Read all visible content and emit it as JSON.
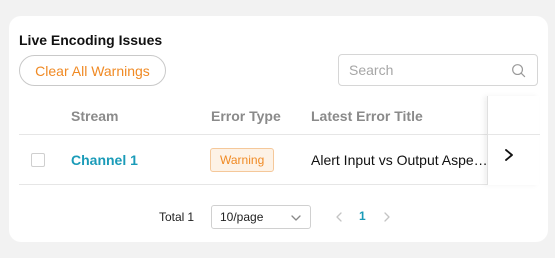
{
  "panel": {
    "title": "Live Encoding Issues",
    "clear_button": "Clear All Warnings",
    "search": {
      "placeholder": "Search",
      "value": ""
    }
  },
  "table": {
    "columns": [
      "Stream",
      "Error Type",
      "Latest Error Title"
    ],
    "rows": [
      {
        "checked": false,
        "stream": "Channel 1",
        "error_type": "Warning",
        "latest_error_title": "Alert Input vs Output Aspe…"
      }
    ]
  },
  "pagination": {
    "total_label": "Total",
    "total": "1",
    "page_size": "10/page",
    "current_page": "1"
  },
  "colors": {
    "accent_orange": "#f08a24",
    "link_teal": "#1a9bb8"
  },
  "icons": [
    "search-icon",
    "chevron-right-icon",
    "chevron-down-icon",
    "chevron-left-icon"
  ]
}
